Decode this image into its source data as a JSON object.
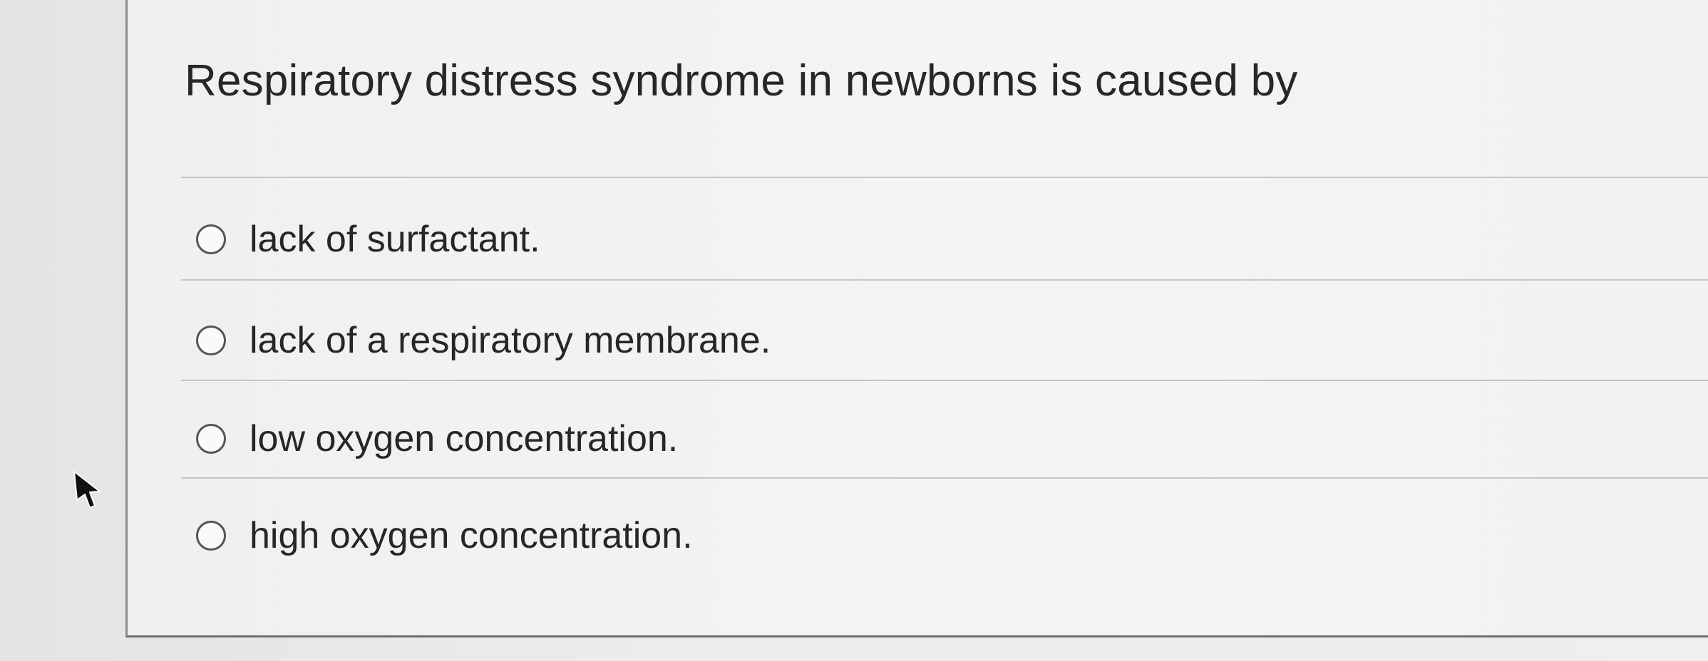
{
  "question": {
    "text": "Respiratory distress syndrome in newborns is caused by"
  },
  "answers": [
    {
      "label": "lack of surfactant.",
      "selected": false
    },
    {
      "label": "lack of a respiratory membrane.",
      "selected": false
    },
    {
      "label": "low oxygen concentration.",
      "selected": false
    },
    {
      "label": "high oxygen concentration.",
      "selected": false
    }
  ],
  "cursor": {
    "icon": "mouse-pointer-icon"
  }
}
